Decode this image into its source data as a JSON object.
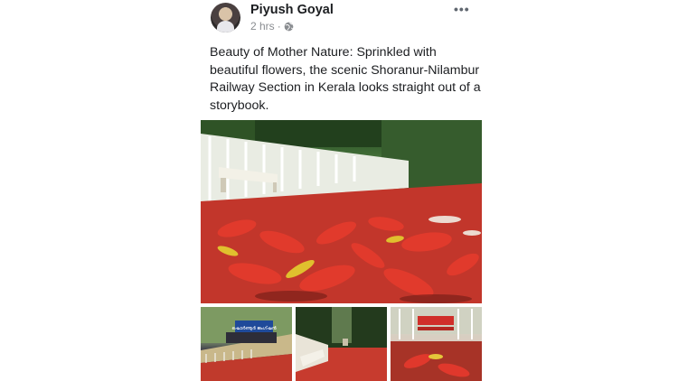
{
  "post": {
    "author_name": "Piyush Goyal",
    "timestamp": "2 hrs",
    "separator": "·",
    "privacy_icon": "globe-icon",
    "more_icon": "more-options-icon",
    "more_glyph": "•••",
    "caption": "Beauty of Mother Nature: Sprinkled with beautiful flowers, the scenic Shoranur-Nilambur Railway Section in Kerala looks straight out of a storybook.",
    "photo_sign_text": "ഷൊർണൂർ ജംഗ്ഷൻ"
  },
  "colors": {
    "text": "#1c1e21",
    "meta": "#8a8d91",
    "petal_red": "#d8302a"
  }
}
